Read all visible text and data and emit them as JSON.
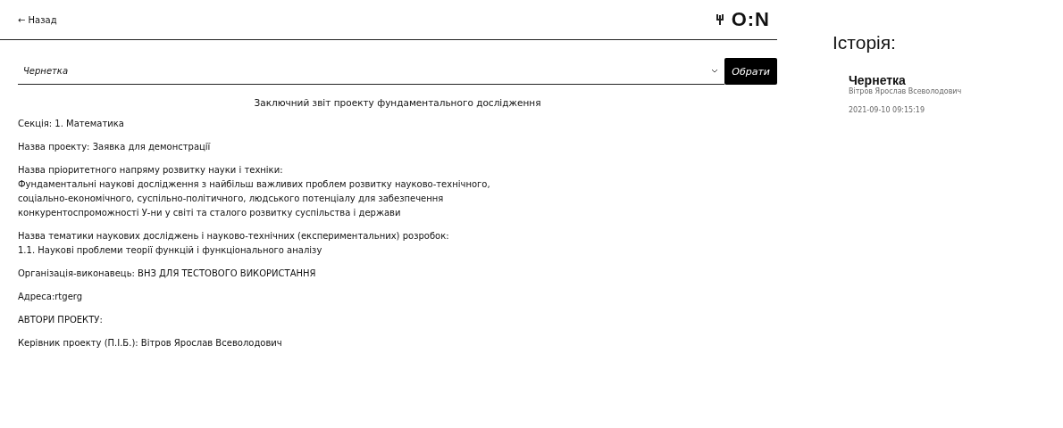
{
  "header": {
    "back": "← Назад",
    "logo": "O:N"
  },
  "status_select": {
    "value": "Чернетка",
    "button": "Обрати"
  },
  "document": {
    "title": "Заключний звіт проекту фундаментального дослідження",
    "paragraphs": [
      {
        "lines": [
          "Секція: 1. Математика"
        ]
      },
      {
        "lines": [
          "Назва проекту: Заявка для демонстрації"
        ]
      },
      {
        "lines": [
          "Назва пріоритетного напряму розвитку науки і техніки:",
          "Фундаментальні наукові дослідження з найбільш важливих проблем розвитку науково-технічного,",
          "соціально-економічного, суспільно-політичного, людського потенціалу для забезпечення",
          "конкурентоспроможності У-ни у світі та сталого розвитку суспільства і держави"
        ]
      },
      {
        "lines": [
          "Назва тематики наукових досліджень і науково-технічних (експериментальних) розробок:",
          "1.1. Наукові проблеми теорії функцій і функціонального аналізу"
        ]
      },
      {
        "lines": [
          "Організація-виконавець: ВНЗ ДЛЯ ТЕСТОВОГО ВИКОРИСТАННЯ"
        ]
      },
      {
        "lines": [
          "Адреса:rtgerg"
        ]
      },
      {
        "lines": [
          "АВТОРИ ПРОЕКТУ:"
        ]
      },
      {
        "lines": [
          "Керівник проекту (П.І.Б.): Вітров Ярослав Всеволодович"
        ]
      }
    ]
  },
  "history": {
    "title": "Історія:",
    "entries": [
      {
        "status": "Чернетка",
        "author": "Вітров Ярослав Всеволодович",
        "date": "2021-09-10 09:15:19"
      }
    ]
  }
}
